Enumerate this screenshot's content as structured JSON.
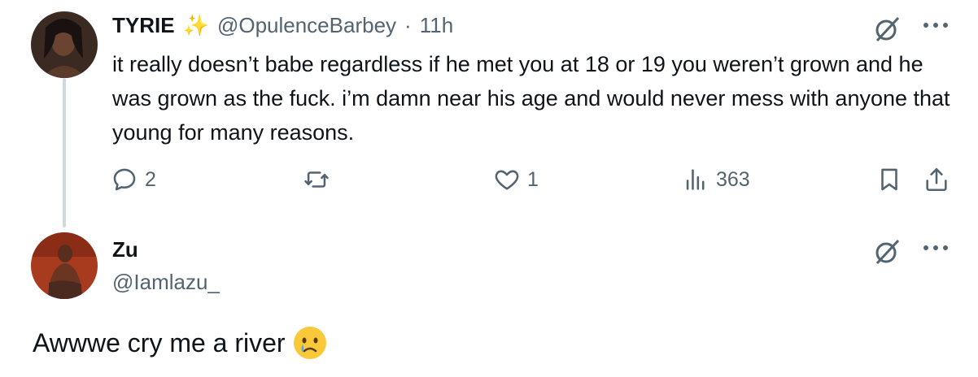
{
  "tweet": {
    "author_name": "TYRIE",
    "author_emoji": "✨",
    "author_handle": "@OpulenceBarbey",
    "separator": "·",
    "time": "11h",
    "text": "it really doesn’t babe regardless if he met you at 18 or 19 you weren’t grown and he was grown as the fuck. i’m damn near his age and would never mess with anyone that young for many reasons.",
    "replies": "2",
    "likes": "1",
    "views": "363"
  },
  "reply": {
    "author_name": "Zu",
    "author_handle": "@Iamlazu_",
    "text": "Awwwe cry me a river",
    "emoji": "😢"
  },
  "colors": {
    "text": "#0f1419",
    "muted": "#536471",
    "thread_line": "#cfd9de",
    "sparkle": "#f6b93b"
  }
}
